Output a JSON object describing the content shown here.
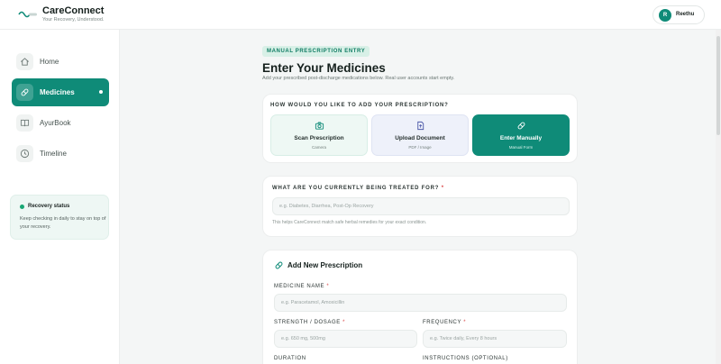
{
  "brand": {
    "title": "CareConnect",
    "subtitle": "Your Recovery, Understood."
  },
  "user": {
    "initial": "R",
    "name": "Reethu"
  },
  "sidebar": {
    "items": [
      {
        "label": "Home",
        "icon": "home-icon",
        "active": false
      },
      {
        "label": "Medicines",
        "icon": "pill-icon",
        "active": true
      },
      {
        "label": "AyurBook",
        "icon": "book-icon",
        "active": false
      },
      {
        "label": "Timeline",
        "icon": "clock-icon",
        "active": false
      }
    ],
    "status": {
      "title": "Recovery status",
      "text": "Keep checking in daily to stay on top of your recovery."
    }
  },
  "main": {
    "badge": "MANUAL PRESCRIPTION ENTRY",
    "title": "Enter Your Medicines",
    "subtitle": "Add your prescribed post-discharge medications below. Real user accounts start empty.",
    "method": {
      "question": "HOW WOULD YOU LIKE TO ADD YOUR PRESCRIPTION?",
      "options": [
        {
          "title": "Scan Prescription",
          "sub": "Camera",
          "icon": "camera-icon"
        },
        {
          "title": "Upload Document",
          "sub": "PDF / Image",
          "icon": "document-upload-icon"
        },
        {
          "title": "Enter Manually",
          "sub": "Manual Form",
          "icon": "pill-icon",
          "selected": true
        }
      ]
    },
    "treatment": {
      "label": "WHAT ARE YOU CURRENTLY BEING TREATED FOR?",
      "required": "*",
      "placeholder": "e.g. Diabetes, Diarrhea, Post-Op Recovery",
      "hint": "This helps CareConnect match safe herbal remedies for your exact condition."
    },
    "prescription": {
      "heading": "Add New Prescription",
      "medicine_label": "MEDICINE NAME",
      "medicine_placeholder": "e.g. Paracetamol, Amoxicillin",
      "strength_label": "STRENGTH / DOSAGE",
      "strength_placeholder": "e.g. 650 mg, 500mg",
      "frequency_label": "FREQUENCY",
      "frequency_placeholder": "e.g. Twice daily, Every 8 hours",
      "duration_label": "DURATION",
      "instructions_label": "INSTRUCTIONS (OPTIONAL)",
      "required": "*"
    }
  },
  "colors": {
    "accent": "#0f8b78",
    "badge_bg": "#d8f0e7",
    "status_dot": "#19a774"
  }
}
